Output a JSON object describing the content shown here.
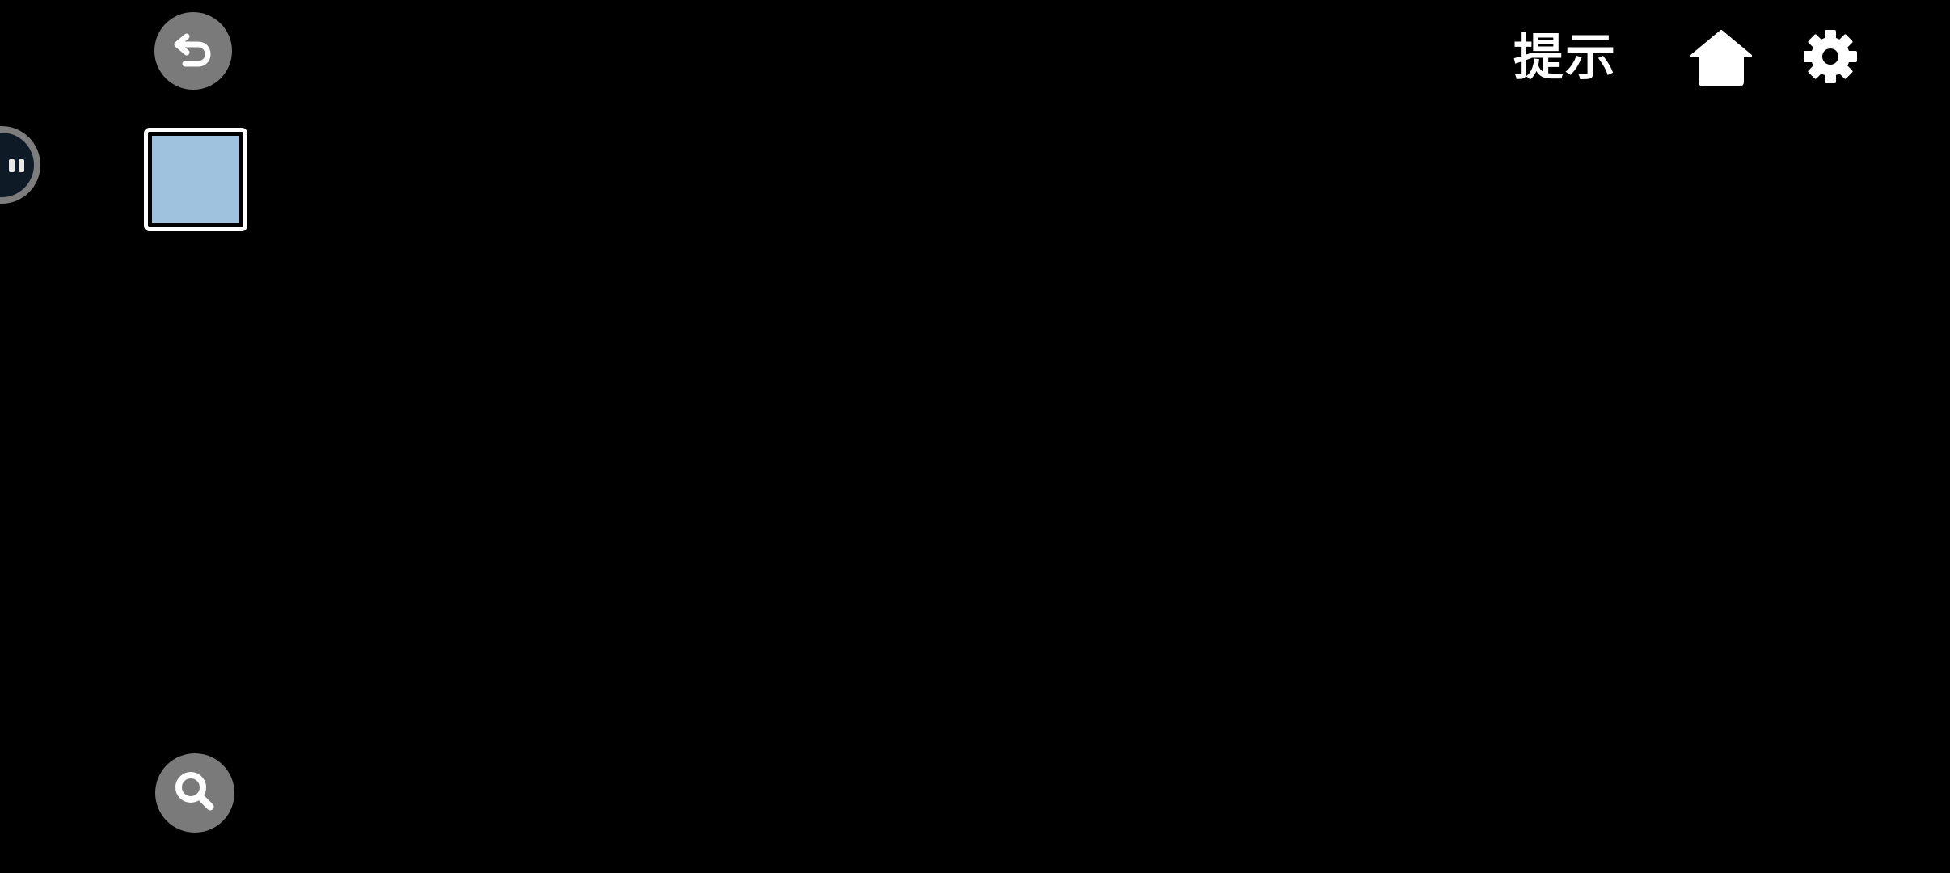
{
  "screen": {
    "background_color": "#000000"
  },
  "controls": {
    "back_icon": "undo-arrow-icon",
    "zoom_icon": "magnifier-icon",
    "floating_assistant_icon": "assistant-face-icon"
  },
  "inventory": {
    "slots": [
      {
        "item_color": "#9fc2de",
        "selected": true
      }
    ]
  },
  "top_bar": {
    "hint_label": "提示",
    "home_icon": "home-icon",
    "settings_icon": "gear-icon"
  },
  "colors": {
    "button_gray": "#7a7a7a",
    "icon_white": "#ffffff",
    "slot_border": "#ffffff"
  }
}
